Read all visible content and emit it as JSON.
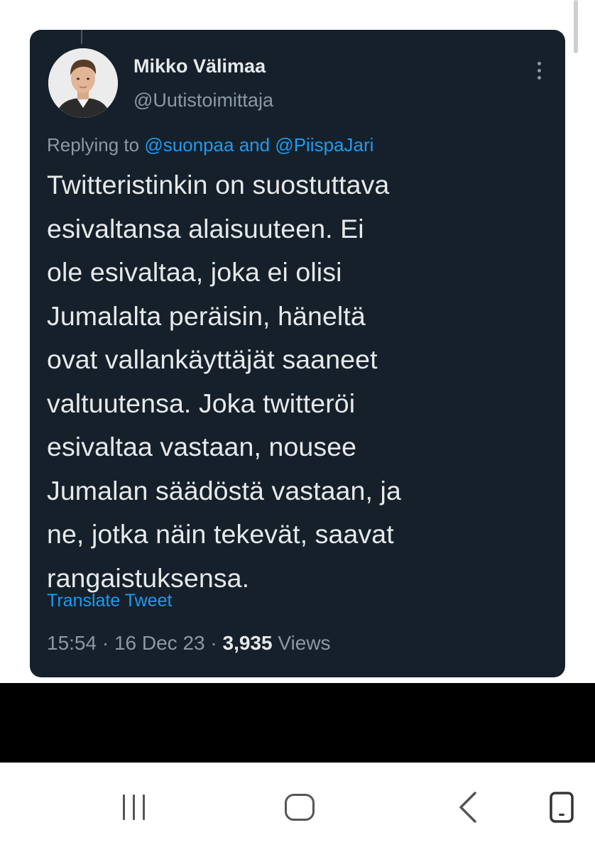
{
  "tweet": {
    "author": {
      "display_name": "Mikko Välimaa",
      "handle": "@Uutistoimittaja"
    },
    "reply": {
      "prefix": "Replying to ",
      "mention_1": "@suonpaa",
      "joiner": " and ",
      "mention_2": "@PiispaJari"
    },
    "text_lines": [
      "Twitteristinkin on suostuttava",
      "esivaltansa alaisuuteen. Ei",
      "ole esivaltaa, joka ei olisi",
      "Jumalalta peräisin, häneltä",
      "ovat vallankäyttäjät saaneet",
      "valtuutensa. Joka twitteröi",
      "esivaltaa vastaan, nousee",
      "Jumalan säädöstä vastaan, ja",
      "ne, jotka näin tekevät, saavat",
      "rangaistuksensa."
    ],
    "translate_label": "Translate Tweet",
    "meta": {
      "time": "15:54",
      "date": "16 Dec 23",
      "views_count": "3,935",
      "views_label": "Views",
      "separator": " · "
    }
  },
  "icons": {
    "more": "more-vertical-icon",
    "recents": "recent-apps-icon",
    "home": "home-icon",
    "back": "back-icon",
    "rotate": "rotate-screen-icon"
  },
  "colors": {
    "card_bg": "#15202b",
    "text_primary": "#e7e9ea",
    "text_secondary": "#8b98a5",
    "link": "#1d9bf0"
  }
}
